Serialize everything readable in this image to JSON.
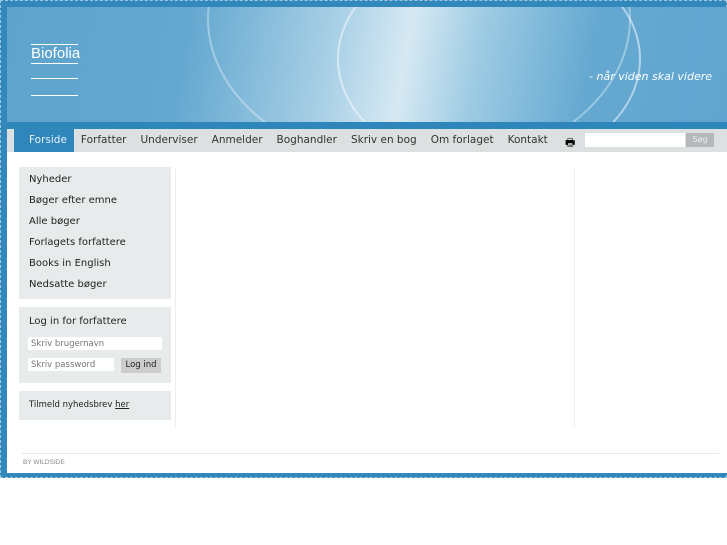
{
  "header": {
    "logo": "Biofolia",
    "tagline": "- når viden skal videre"
  },
  "nav": {
    "items": [
      "Forside",
      "Forfatter",
      "Underviser",
      "Anmelder",
      "Boghandler",
      "Skriv en bog",
      "Om forlaget",
      "Kontakt"
    ],
    "active": "Forside",
    "print_icon": "printer-icon",
    "search_placeholder": "",
    "search_button": "Søg"
  },
  "sidebar": {
    "links": [
      "Nyheder",
      "Bøger efter emne",
      "Alle bøger",
      "Forlagets forfattere",
      "Books in English",
      "Nedsatte bøger"
    ],
    "login": {
      "title": "Log in for forfattere",
      "username_placeholder": "Skriv brugernavn",
      "password_placeholder": "Skriv password",
      "button": "Log ind"
    },
    "newsletter": {
      "text": "Tilmeld nyhedsbrev ",
      "link": "her"
    }
  },
  "footer": {
    "byline": "BY WILDSIDE"
  },
  "colors": {
    "brand_blue": "#2f86bb",
    "nav_gray": "#dde0e1",
    "box_gray": "#e8ebec"
  }
}
